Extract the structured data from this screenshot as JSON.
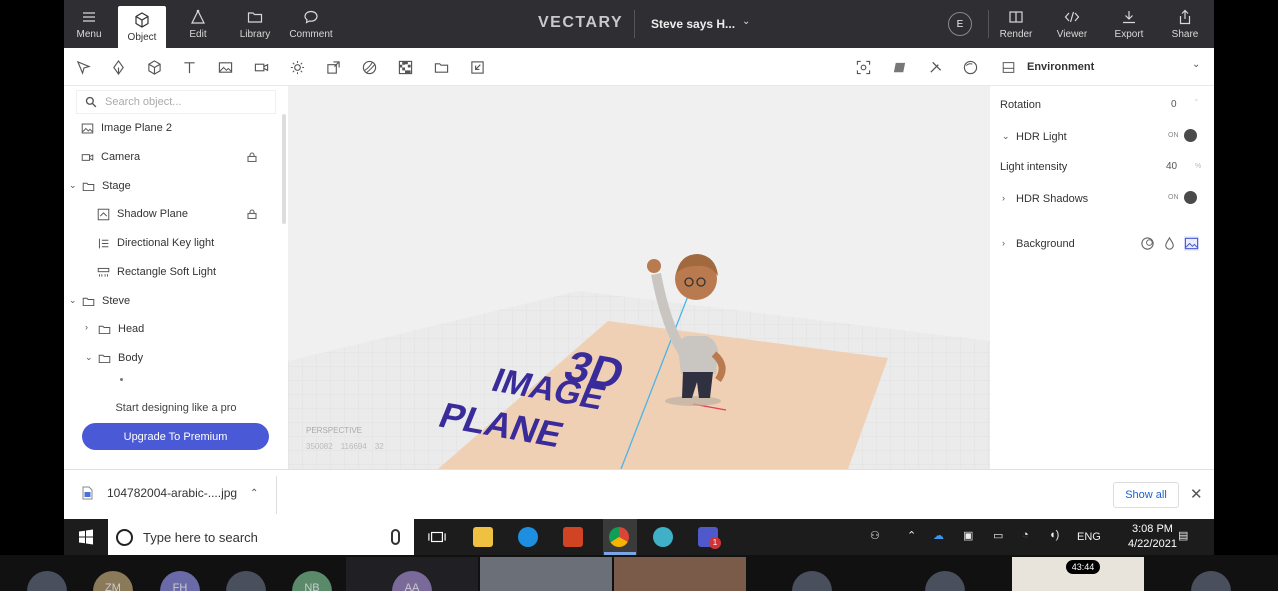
{
  "topbar": {
    "menu": "Menu",
    "object": "Object",
    "edit": "Edit",
    "library": "Library",
    "comment": "Comment",
    "logo": "VECTARY",
    "project_title": "Steve says H...",
    "avatar": "E",
    "render": "Render",
    "viewer": "Viewer",
    "export": "Export",
    "share": "Share"
  },
  "search": {
    "placeholder": "Search object..."
  },
  "tree": {
    "image_plane": "Image Plane 2",
    "camera": "Camera",
    "stage": "Stage",
    "shadow_plane": "Shadow Plane",
    "directional": "Directional Key light",
    "rectangle": "Rectangle Soft Light",
    "steve": "Steve",
    "head": "Head",
    "body": "Body"
  },
  "promo": {
    "text": "Start designing like a pro",
    "button": "Upgrade To Premium"
  },
  "viewport": {
    "mode": "PERSPECTIVE",
    "stat1": "350082",
    "stat2": "116694",
    "stat3": "32"
  },
  "environment": {
    "title": "Environment",
    "rotation_label": "Rotation",
    "rotation_value": "0",
    "rotation_unit": "°",
    "hdr_light": "HDR Light",
    "hdr_light_toggle": "ON",
    "intensity_label": "Light intensity",
    "intensity_value": "40",
    "intensity_unit": "%",
    "hdr_shadows": "HDR Shadows",
    "hdr_shadows_toggle": "ON",
    "background": "Background"
  },
  "download": {
    "filename": "104782004-arabic-....jpg",
    "show_all": "Show all"
  },
  "taskbar": {
    "search_placeholder": "Type here to search",
    "lang": "ENG",
    "time": "3:08 PM",
    "date": "4/22/2021",
    "badge": "1"
  },
  "zoom": {
    "timer": "43:44",
    "p1": "ZM",
    "p2": "FH",
    "p3": "NB",
    "p4": "AA"
  },
  "colors": {
    "accent": "#4a5ad6",
    "topbar": "#2f2f33",
    "plane_text": "#3a2b9a"
  }
}
